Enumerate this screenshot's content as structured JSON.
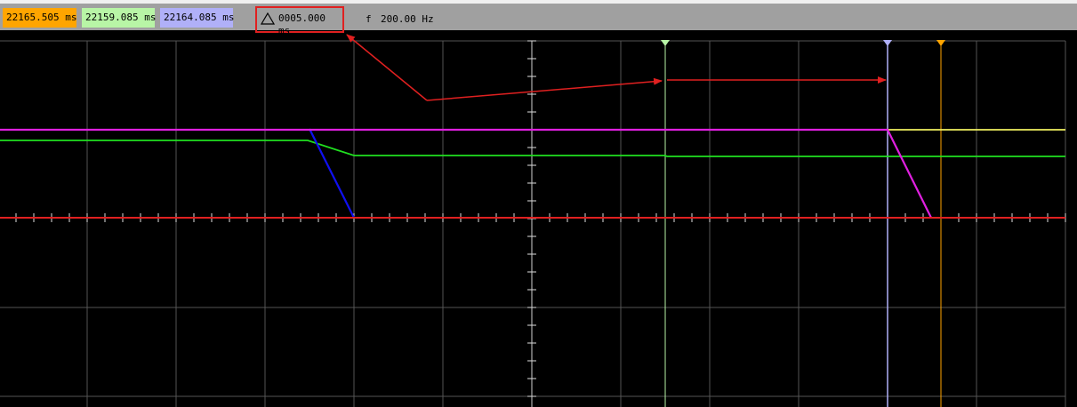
{
  "toolbar": {
    "cursor_orange": "22165.505 ms",
    "cursor_green": "22159.085 ms",
    "cursor_blue": "22164.085 ms",
    "delta_value": "0005.000 ms",
    "freq_symbol": "f",
    "freq_value": "200.00 Hz"
  },
  "colors": {
    "orange_cursor": "#ffa500",
    "green_cursor": "#b8f5a6",
    "blue_cursor": "#b0b0f8",
    "trace_magenta": "#e020e0",
    "trace_green": "#20e020",
    "trace_yellow": "#f0f060",
    "trace_blue": "#1010f0",
    "trace_red": "#e02020",
    "annotation_red": "#e02020",
    "grid": "#555555"
  },
  "icons": {
    "delta": "delta-triangle-icon"
  }
}
